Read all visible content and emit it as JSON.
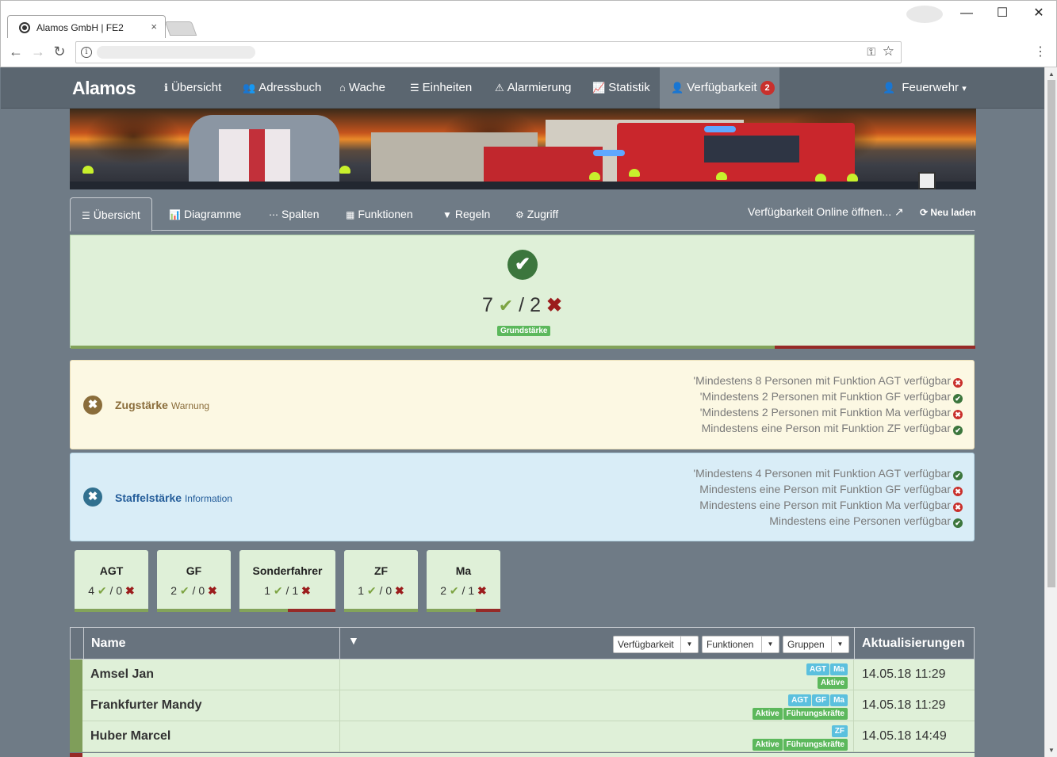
{
  "browser": {
    "tab_title": "Alamos GmbH | FE2",
    "tab_close": "×",
    "win_min": "—",
    "win_max": "☐",
    "win_close": "✕",
    "back": "←",
    "forward": "→",
    "reload": "↻",
    "info": "i",
    "key": "⚿",
    "star": "☆",
    "menu": "⋮"
  },
  "navbar": {
    "brand": "Alamos",
    "items": [
      {
        "icon": "ℹ",
        "label": "Übersicht"
      },
      {
        "icon": "👥",
        "label": "Adressbuch"
      },
      {
        "icon": "⌂",
        "label": "Wache"
      },
      {
        "icon": "☰",
        "label": "Einheiten"
      },
      {
        "icon": "⚠",
        "label": "Alarmierung"
      },
      {
        "icon": "📈",
        "label": "Statistik"
      },
      {
        "icon": "👤",
        "label": "Verfügbarkeit",
        "badge": "2"
      }
    ],
    "user": {
      "icon": "👤",
      "label": "Feuerwehr",
      "caret": "▾"
    }
  },
  "tabs": {
    "items": [
      {
        "icon": "☰",
        "label": "Übersicht"
      },
      {
        "icon": "📊",
        "label": "Diagramme"
      },
      {
        "icon": "⋯",
        "label": "Spalten"
      },
      {
        "icon": "▦",
        "label": "Funktionen"
      },
      {
        "icon": "▼",
        "label": "Regeln"
      },
      {
        "icon": "⚙",
        "label": "Zugriff"
      }
    ],
    "online_label": "Verfügbarkeit Online öffnen...",
    "online_icon": "↗",
    "reload_icon": "⟳",
    "reload_label": "Neu laden"
  },
  "main_panel": {
    "check_icon": "✔",
    "available": "7",
    "sep": " / ",
    "unavailable": "2",
    "ok_mark": "✔",
    "no_mark": "✖",
    "badge": "Grundstärke",
    "ratio_available": 0.778
  },
  "rules": {
    "zug": {
      "icon": "✖",
      "title": "Zugstärke",
      "subtitle": "Warnung",
      "lines": [
        {
          "text": "'Mindestens 8 Personen mit Funktion AGT verfügbar",
          "ok": false
        },
        {
          "text": "'Mindestens 2 Personen mit Funktion GF verfügbar",
          "ok": true
        },
        {
          "text": "'Mindestens 2 Personen mit Funktion Ma verfügbar",
          "ok": false
        },
        {
          "text": "Mindestens eine Person mit Funktion ZF verfügbar",
          "ok": true
        }
      ]
    },
    "staffel": {
      "icon": "✖",
      "title": "Staffelstärke",
      "subtitle": "Information",
      "lines": [
        {
          "text": "'Mindestens 4 Personen mit Funktion AGT verfügbar",
          "ok": true
        },
        {
          "text": "Mindestens eine Person mit Funktion GF verfügbar",
          "ok": false
        },
        {
          "text": "Mindestens eine Person mit Funktion Ma verfügbar",
          "ok": false
        },
        {
          "text": "Mindestens eine Personen verfügbar",
          "ok": true
        }
      ]
    }
  },
  "functions": [
    {
      "name": "AGT",
      "ok": "4",
      "no": "0",
      "ratio": 1.0
    },
    {
      "name": "GF",
      "ok": "2",
      "no": "0",
      "ratio": 1.0
    },
    {
      "name": "Sonderfahrer",
      "ok": "1",
      "no": "1",
      "ratio": 0.5
    },
    {
      "name": "ZF",
      "ok": "1",
      "no": "0",
      "ratio": 1.0
    },
    {
      "name": "Ma",
      "ok": "2",
      "no": "1",
      "ratio": 0.667
    }
  ],
  "table": {
    "col_name": "Name",
    "filter_icon": "▼",
    "dd_availability": "Verfügbarkeit",
    "dd_functions": "Funktionen",
    "dd_groups": "Gruppen",
    "caret": "▼",
    "col_updates": "Aktualisierungen",
    "rows": [
      {
        "name": "Amsel Jan",
        "functions": [
          "AGT",
          "Ma"
        ],
        "groups": [
          "Aktive"
        ],
        "updated": "14.05.18 11:29"
      },
      {
        "name": "Frankfurter Mandy",
        "functions": [
          "AGT",
          "GF",
          "Ma"
        ],
        "groups": [
          "Aktive",
          "Führungskräfte"
        ],
        "updated": "14.05.18 11:29"
      },
      {
        "name": "Huber Marcel",
        "functions": [
          "ZF"
        ],
        "groups": [
          "Aktive",
          "Führungskräfte"
        ],
        "updated": "14.05.18 14:49"
      }
    ]
  },
  "colors": {
    "success_bg": "#dff0d8",
    "warning_bg": "#fcf8e3",
    "info_bg": "#d9edf7",
    "ok_green": "#7da443",
    "no_red": "#9b1c1c",
    "navbar": "#5b6670"
  }
}
